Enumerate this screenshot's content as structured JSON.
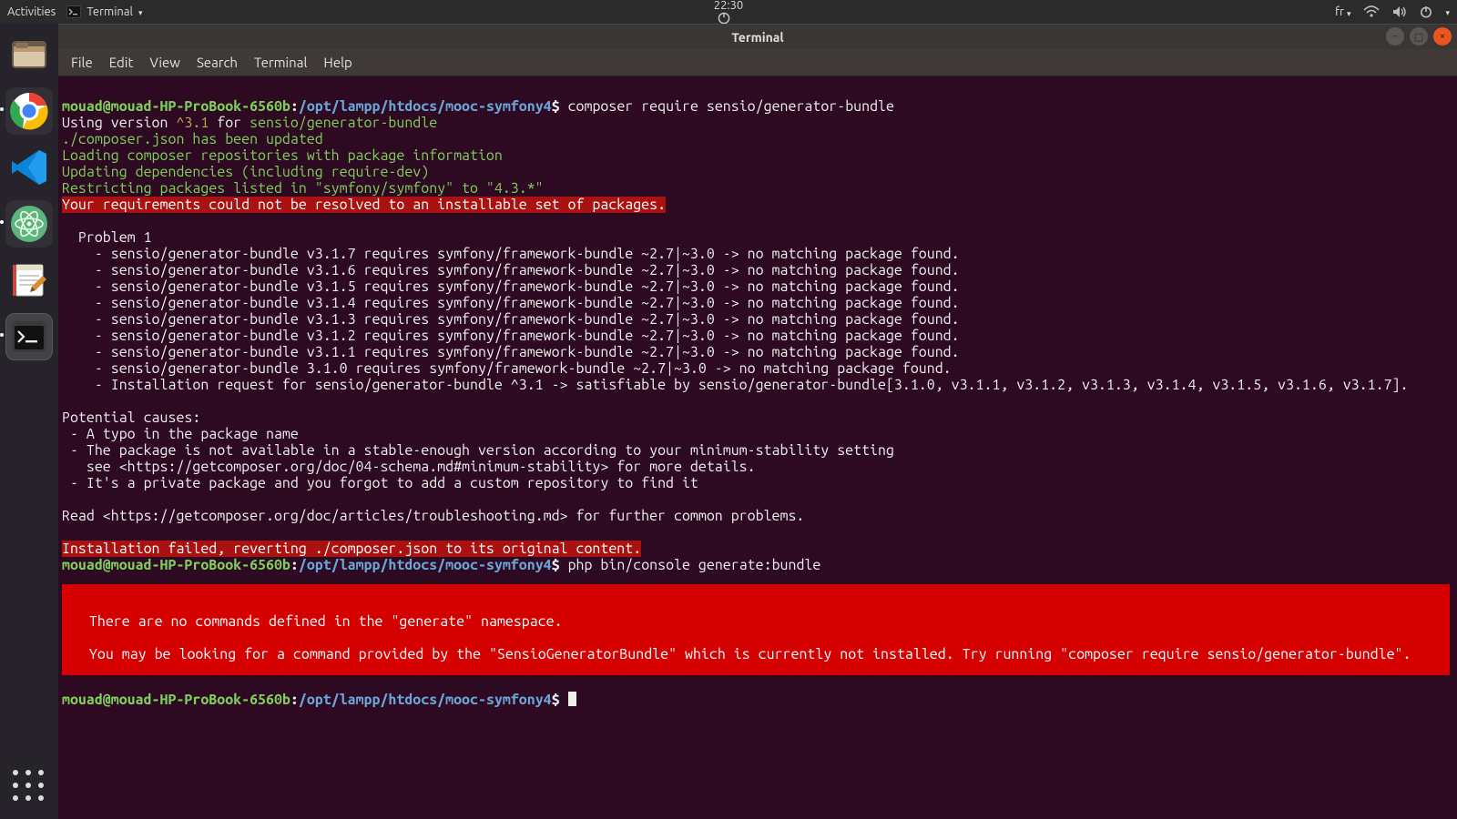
{
  "topbar": {
    "activities": "Activities",
    "app_name": "Terminal",
    "clock": "22:30",
    "lang": "fr"
  },
  "icons": {
    "terminal_menu": "terminal-app-icon",
    "wifi": "wifi-icon",
    "volume": "volume-icon",
    "power": "power-icon",
    "caret": "chevron-down-icon",
    "clock_badge": "power-badge-icon"
  },
  "window": {
    "title": "Terminal"
  },
  "menu": [
    "File",
    "Edit",
    "View",
    "Search",
    "Terminal",
    "Help"
  ],
  "winbtn": {
    "min": "−",
    "max": "□",
    "close": "×"
  },
  "dock": {
    "items": [
      {
        "name": "files-launcher",
        "title": "Files"
      },
      {
        "name": "chrome-launcher",
        "title": "Chrome"
      },
      {
        "name": "vscode-launcher",
        "title": "VS Code"
      },
      {
        "name": "atom-launcher",
        "title": "Atom"
      },
      {
        "name": "gedit-launcher",
        "title": "Text Editor"
      },
      {
        "name": "terminal-launcher",
        "title": "Terminal"
      }
    ]
  },
  "terminal": {
    "user": "mouad@mouad-HP-ProBook-6560b",
    "path": "/opt/lampp/htdocs/mooc-symfony4",
    "dollar": "$",
    "cmd1": "composer require sensio/generator-bundle",
    "l_using_a": "Using version ",
    "l_using_b": "^3.1",
    "l_using_c": " for ",
    "l_using_d": "sensio/generator-bundle",
    "l_updated": "./composer.json has been updated",
    "l_loading": "Loading composer repositories with package information",
    "l_updating": "Updating dependencies (including require-dev)",
    "l_restrict": "Restricting packages listed in \"symfony/symfony\" to \"4.3.*\"",
    "l_err1": "Your requirements could not be resolved to an installable set of packages.",
    "problem_header": "  Problem 1",
    "problems": [
      "    - sensio/generator-bundle v3.1.7 requires symfony/framework-bundle ~2.7|~3.0 -> no matching package found.",
      "    - sensio/generator-bundle v3.1.6 requires symfony/framework-bundle ~2.7|~3.0 -> no matching package found.",
      "    - sensio/generator-bundle v3.1.5 requires symfony/framework-bundle ~2.7|~3.0 -> no matching package found.",
      "    - sensio/generator-bundle v3.1.4 requires symfony/framework-bundle ~2.7|~3.0 -> no matching package found.",
      "    - sensio/generator-bundle v3.1.3 requires symfony/framework-bundle ~2.7|~3.0 -> no matching package found.",
      "    - sensio/generator-bundle v3.1.2 requires symfony/framework-bundle ~2.7|~3.0 -> no matching package found.",
      "    - sensio/generator-bundle v3.1.1 requires symfony/framework-bundle ~2.7|~3.0 -> no matching package found.",
      "    - sensio/generator-bundle 3.1.0 requires symfony/framework-bundle ~2.7|~3.0 -> no matching package found.",
      "    - Installation request for sensio/generator-bundle ^3.1 -> satisfiable by sensio/generator-bundle[3.1.0, v3.1.1, v3.1.2, v3.1.3, v3.1.4, v3.1.5, v3.1.6, v3.1.7]."
    ],
    "causes_hdr": "Potential causes:",
    "causes": [
      " - A typo in the package name",
      " - The package is not available in a stable-enough version according to your minimum-stability setting",
      "   see <https://getcomposer.org/doc/04-schema.md#minimum-stability> for more details.",
      " - It's a private package and you forgot to add a custom repository to find it"
    ],
    "read_more": "Read <https://getcomposer.org/doc/articles/troubleshooting.md> for further common problems.",
    "l_err2": "Installation failed, reverting ./composer.json to its original content.",
    "cmd2": "php bin/console generate:bundle",
    "big_err_1": "  There are no commands defined in the \"generate\" namespace.",
    "big_err_2": "  You may be looking for a command provided by the \"SensioGeneratorBundle\" which is currently not installed. Try running \"composer require sensio/generator-bundle\"."
  }
}
